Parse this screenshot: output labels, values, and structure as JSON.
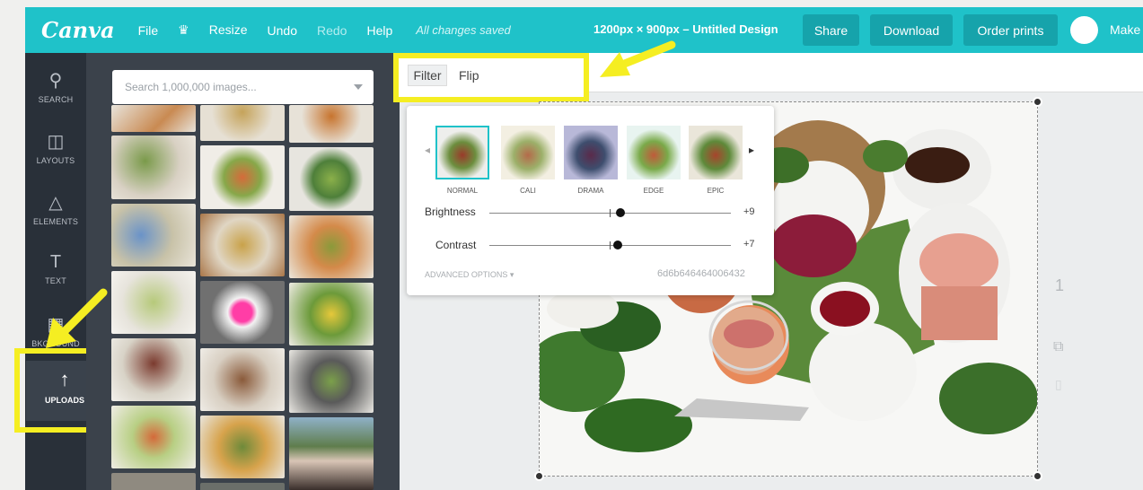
{
  "header": {
    "logo": "Canva",
    "menu": [
      "File",
      "Resize",
      "Undo",
      "Redo",
      "Help"
    ],
    "saved_status": "All changes saved",
    "doc_title": "1200px × 900px – Untitled Design",
    "share": "Share",
    "download": "Download",
    "order_prints": "Order prints",
    "make": "Make"
  },
  "sidebar": {
    "items": [
      {
        "icon": "search-icon",
        "label": "SEARCH"
      },
      {
        "icon": "layouts-icon",
        "label": "LAYOUTS"
      },
      {
        "icon": "elements-icon",
        "label": "ELEMENTS"
      },
      {
        "icon": "text-icon",
        "label": "TEXT"
      },
      {
        "icon": "background-icon",
        "label": "BKGROUND"
      }
    ],
    "uploads_label": "UPLOADS"
  },
  "search": {
    "placeholder": "Search 1,000,000 images..."
  },
  "toolbar": {
    "filter": "Filter",
    "flip": "Flip"
  },
  "filter_popup": {
    "filters": [
      "NORMAL",
      "CALI",
      "DRAMA",
      "EDGE",
      "EPIC"
    ],
    "selected": "NORMAL",
    "brightness_label": "Brightness",
    "brightness_value": "+9",
    "contrast_label": "Contrast",
    "contrast_value": "+7",
    "advanced": "ADVANCED OPTIONS",
    "code": "6d6b646464006432"
  },
  "page_number": "1",
  "colors": {
    "brand": "#1fc2c9",
    "highlight": "#f5ee22",
    "sidebar": "#293039"
  }
}
